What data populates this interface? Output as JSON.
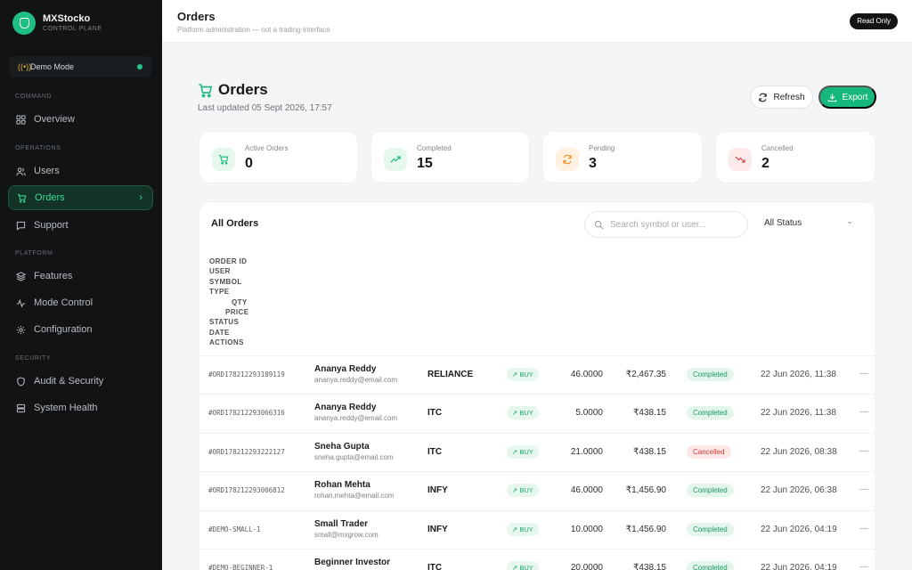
{
  "brand": {
    "name": "MXStocko",
    "subtitle": "CONTROL PLANE"
  },
  "mode": {
    "label": "Demo Mode",
    "status_color": "#23c486"
  },
  "sidebar": {
    "sections": [
      "COMMAND",
      "OPERATIONS",
      "PLATFORM",
      "SECURITY"
    ],
    "items": [
      {
        "label": "Overview",
        "icon": "grid-icon"
      },
      {
        "label": "Users",
        "icon": "users-icon"
      },
      {
        "label": "Orders",
        "icon": "cart-icon",
        "active": true
      },
      {
        "label": "Support",
        "icon": "message-icon"
      },
      {
        "label": "Features",
        "icon": "layers-icon"
      },
      {
        "label": "Mode Control",
        "icon": "activity-icon"
      },
      {
        "label": "Configuration",
        "icon": "gear-icon"
      },
      {
        "label": "Audit & Security",
        "icon": "shield-icon"
      },
      {
        "label": "System Health",
        "icon": "server-icon"
      }
    ]
  },
  "header": {
    "title": "Orders",
    "subtitle": "Platform administration — not a trading interface",
    "badge": "Read Only"
  },
  "page": {
    "title": "Orders",
    "updated": "Last updated 05 Sept 2026, 17:57",
    "refresh_label": "Refresh",
    "export_label": "Export",
    "accent": "#16b97b"
  },
  "stats": [
    {
      "label": "Active Orders",
      "value": "0",
      "icon": "cart-icon"
    },
    {
      "label": "Completed",
      "value": "15",
      "icon": "trending-up-icon"
    },
    {
      "label": "Pending",
      "value": "3",
      "icon": "refresh-icon"
    },
    {
      "label": "Cancelled",
      "value": "2",
      "icon": "trending-down-icon"
    }
  ],
  "table": {
    "title": "All Orders",
    "search_placeholder": "Search symbol or user...",
    "status_filter": "All Status",
    "columns": [
      "ORDER ID",
      "USER",
      "SYMBOL",
      "TYPE",
      "QTY",
      "PRICE",
      "STATUS",
      "DATE",
      "ACTIONS"
    ],
    "rows": [
      {
        "id": "#ORD178212293109119",
        "name": "Ananya Reddy",
        "email": "ananya.reddy@email.com",
        "symbol": "RELIANCE",
        "type": "BUY",
        "qty": "46.0000",
        "price": "₹2,467.35",
        "status": "Completed",
        "date": "22 Jun 2026, 11:38",
        "action": "—"
      },
      {
        "id": "#ORD178212293066316",
        "name": "Ananya Reddy",
        "email": "ananya.reddy@email.com",
        "symbol": "ITC",
        "type": "BUY",
        "qty": "5.0000",
        "price": "₹438.15",
        "status": "Completed",
        "date": "22 Jun 2026, 11:38",
        "action": "—"
      },
      {
        "id": "#ORD178212293222127",
        "name": "Sneha Gupta",
        "email": "sneha.gupta@email.com",
        "symbol": "ITC",
        "type": "BUY",
        "qty": "21.0000",
        "price": "₹438.15",
        "status": "Cancelled",
        "date": "22 Jun 2026, 08:38",
        "action": "—"
      },
      {
        "id": "#ORD178212293006812",
        "name": "Rohan Mehta",
        "email": "rohan.mehta@email.com",
        "symbol": "INFY",
        "type": "BUY",
        "qty": "46.0000",
        "price": "₹1,456.90",
        "status": "Completed",
        "date": "22 Jun 2026, 06:38",
        "action": "—"
      },
      {
        "id": "#DEMO-SMALL-1",
        "name": "Small Trader",
        "email": "small@mxgrow.com",
        "symbol": "INFY",
        "type": "BUY",
        "qty": "10.0000",
        "price": "₹1,456.90",
        "status": "Completed",
        "date": "22 Jun 2026, 04:19",
        "action": "—"
      },
      {
        "id": "#DEMO-BEGINNER-1",
        "name": "Beginner Investor",
        "email": "",
        "symbol": "ITC",
        "type": "BUY",
        "qty": "20.0000",
        "price": "₹438.15",
        "status": "Completed",
        "date": "22 Jun 2026, 04:19",
        "action": "—"
      }
    ]
  }
}
